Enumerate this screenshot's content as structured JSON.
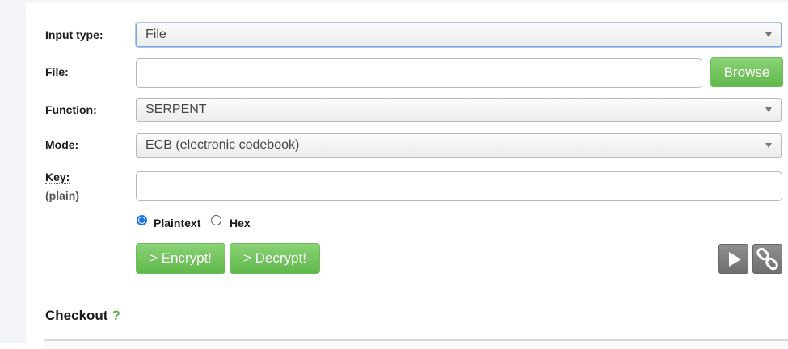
{
  "form": {
    "input_type": {
      "label": "Input type:",
      "value": "File"
    },
    "file": {
      "label": "File:",
      "value": "",
      "browse_label": "Browse"
    },
    "function": {
      "label": "Function:",
      "value": "SERPENT"
    },
    "mode": {
      "label": "Mode:",
      "value": "ECB (electronic codebook)"
    },
    "key": {
      "label": "Key:",
      "sublabel": "(plain)",
      "value": ""
    },
    "key_format": {
      "options": [
        {
          "label": "Plaintext",
          "checked": true
        },
        {
          "label": "Hex",
          "checked": false
        }
      ]
    },
    "actions": {
      "encrypt_label": "> Encrypt!",
      "decrypt_label": "> Decrypt!"
    },
    "tools": {
      "play_icon": "play-icon",
      "link_icon": "link-icon"
    }
  },
  "checkout": {
    "title": "Checkout",
    "help": "?"
  },
  "colors": {
    "accent_green": "#5fb94a",
    "focus_blue": "#7fa6d9",
    "radio_blue": "#1a73e8"
  }
}
